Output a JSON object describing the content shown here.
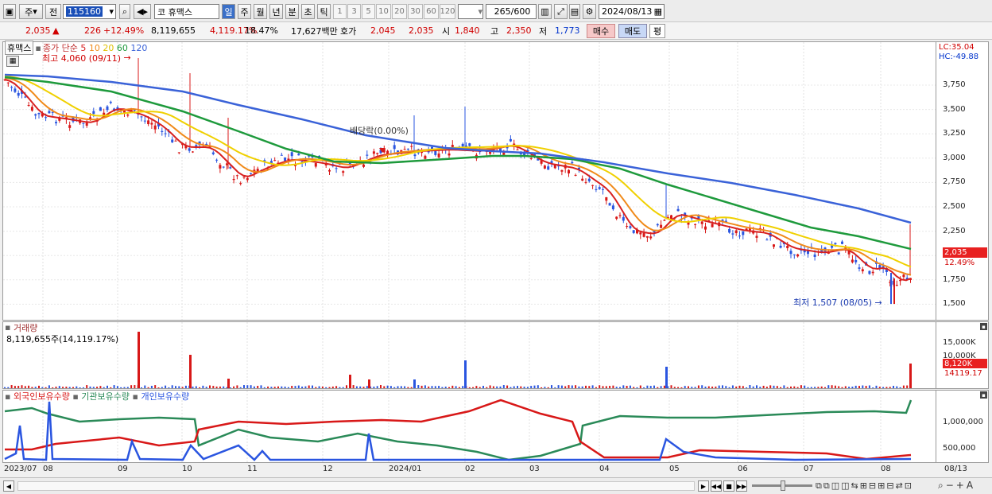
{
  "toolbar": {
    "period_type": "주",
    "prev_label": "전",
    "code": "115160",
    "name_prefix": "코",
    "name": "휴맥스",
    "period_tabs": [
      "일",
      "주",
      "월",
      "년",
      "분",
      "초",
      "틱"
    ],
    "intervals": [
      "1",
      "3",
      "5",
      "10",
      "20",
      "30",
      "60",
      "120"
    ],
    "count": "265",
    "count_max": "/600",
    "date": "2024/08/13"
  },
  "quote": {
    "price": "2,035",
    "arrow": "▲",
    "change": "226",
    "change_pct": "+12.49%",
    "volume": "8,119,655",
    "volume_pct": "4,119.17%",
    "turnover": "18.47%",
    "amount": "17,627백만",
    "ask_label": "호가",
    "ask": "2,045",
    "bid": "2,035",
    "open_label": "시",
    "open": "1,840",
    "high_label": "고",
    "high": "2,350",
    "low_label": "저",
    "low": "1,773",
    "buy": "매수",
    "sell": "매도",
    "avg": "평"
  },
  "price_panel": {
    "stock_label": "휴맥스",
    "ma_title": "종가 단순",
    "ma_periods": [
      "5",
      "10",
      "20",
      "60",
      "120"
    ],
    "ma_colors": [
      "#d82020",
      "#f08a1a",
      "#f0d000",
      "#1e9a3c",
      "#3a62d8"
    ],
    "max_label": "최고 4,060 (09/11)",
    "min_label": "최저 1,507 (08/05)",
    "dividend_label": "배당락(0.00%)",
    "lc": "LC:35.04",
    "hc": "HC:-49.88",
    "y_ticks": [
      "3,750",
      "3,500",
      "3,250",
      "3,000",
      "2,750",
      "2,500",
      "2,250",
      "2,000",
      "1,750",
      "1,500"
    ],
    "current_tag": "2,035",
    "current_pct": "12.49%"
  },
  "volume_panel": {
    "title": "거래량",
    "value": "8,119,655주(14,119.17%)",
    "y_ticks": [
      "15,000K",
      "10,000K"
    ],
    "current_tag": "8,120K",
    "current_pct": "14119.17"
  },
  "holders_panel": {
    "series": [
      "외국인보유수량",
      "기관보유수량",
      "개인보유수량"
    ],
    "series_colors": [
      "#d81818",
      "#2a8a58",
      "#2a55e0"
    ],
    "y_ticks": [
      "1,000,000",
      "500,000"
    ]
  },
  "x_labels": [
    "2023/07",
    "08",
    "09",
    "10",
    "11",
    "12",
    "2024/01",
    "02",
    "03",
    "04",
    "05",
    "06",
    "07",
    "08",
    "08/13"
  ]
}
